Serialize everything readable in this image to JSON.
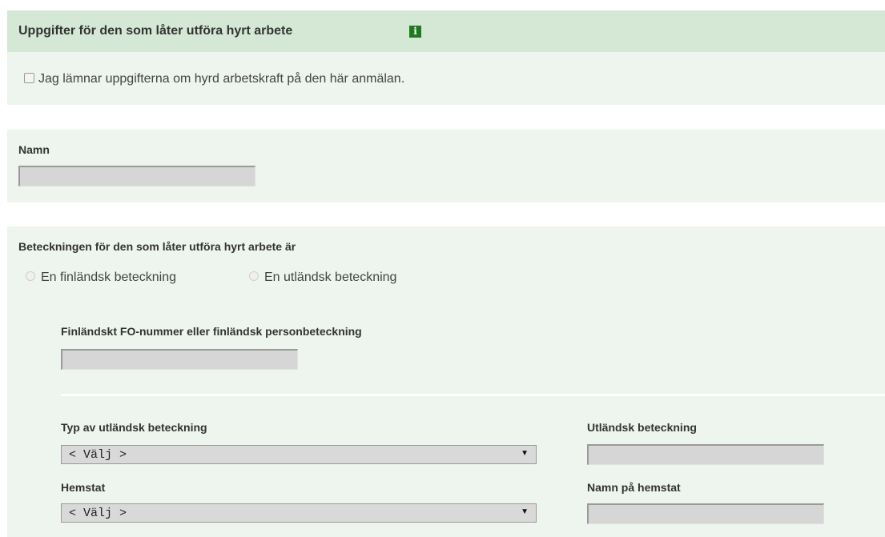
{
  "header": {
    "title": "Uppgifter för den som låter utföra hyrt arbete",
    "info_icon_glyph": "i",
    "info_icon": "info-icon"
  },
  "consent": {
    "checkbox_label": "Jag lämnar uppgifterna om hyrd arbetskraft på den här anmälan.",
    "checked": false
  },
  "name_section": {
    "label": "Namn",
    "value": ""
  },
  "identifier_section": {
    "label": "Beteckningen för den som låter utföra hyrt arbete är",
    "options": [
      {
        "label": "En finländsk beteckning",
        "selected": false
      },
      {
        "label": "En utländsk beteckning",
        "selected": false
      }
    ],
    "finnish_label": "Finländskt FO-nummer eller finländsk personbeteckning",
    "finnish_value": "",
    "foreign_type_label": "Typ av utländsk beteckning",
    "foreign_type_value": "< Välj >",
    "foreign_id_label": "Utländsk beteckning",
    "foreign_id_value": "",
    "home_state_label": "Hemstat",
    "home_state_value": "< Välj >",
    "home_state_name_label": "Namn på hemstat",
    "home_state_name_value": "",
    "select_arrow_glyph": "▼"
  },
  "colors": {
    "header_bg": "#d4e8d5",
    "panel_bg": "#eef4ee",
    "info_icon_bg": "#1f7a1f"
  }
}
